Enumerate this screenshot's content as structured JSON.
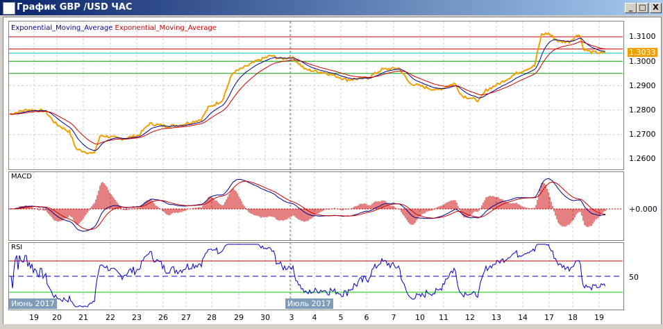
{
  "window": {
    "title": "График GBP /USD  ЧАС",
    "minimize": "_",
    "maximize": "□",
    "close": "X"
  },
  "main_chart": {
    "legend": [
      "Exponential_Moving_Average",
      "Exponential_Moving_Average"
    ],
    "colors": {
      "price": "#f0a000",
      "ema_fast": "#00008b",
      "ema_slow": "#cc0000",
      "last_price_bg": "#f0a000"
    },
    "y_ticks": [
      "1.3100",
      "1.3000",
      "1.2900",
      "1.2800",
      "1.2700",
      "1.2600"
    ],
    "last_price": "1.3033",
    "levels": [
      {
        "value": 1.31,
        "color": "#cc0000"
      },
      {
        "value": 1.305,
        "color": "#cc0000"
      },
      {
        "value": 1.3033,
        "color": "#00cccc"
      },
      {
        "value": 1.3,
        "color": "#00aa00"
      },
      {
        "value": 1.295,
        "color": "#00aa00"
      }
    ],
    "price": [
      1.2782,
      1.2802,
      1.2796,
      1.2745,
      1.2711,
      1.264,
      1.262,
      1.2697,
      1.2682,
      1.2697,
      1.2745,
      1.2734,
      1.2739,
      1.2762,
      1.281,
      1.2839,
      1.2952,
      1.2972,
      1.3001,
      1.3023,
      1.3009,
      1.3018,
      1.2966,
      1.2952,
      1.2924,
      1.2932,
      1.2966,
      1.2972,
      1.291,
      1.2895,
      1.2881,
      1.291,
      1.2859,
      1.2839,
      1.2881,
      1.291,
      1.2952,
      1.2981,
      1.3109,
      1.3114,
      1.308,
      1.308,
      1.3114,
      1.3052,
      1.3038,
      1.3033
    ]
  },
  "macd": {
    "label": "MACD",
    "zero_label": "+0.000"
  },
  "rsi": {
    "label": "RSI",
    "level_label": "50"
  },
  "x_axis": {
    "months": [
      "Июнь 2017",
      "Июль 2017"
    ],
    "days": [
      "19",
      "20",
      "21",
      "22",
      "23",
      "26",
      "27",
      "28",
      "29",
      "30",
      "3",
      "4",
      "5",
      "6",
      "7",
      "10",
      "11",
      "12",
      "13",
      "14",
      "17",
      "18",
      "19"
    ]
  }
}
